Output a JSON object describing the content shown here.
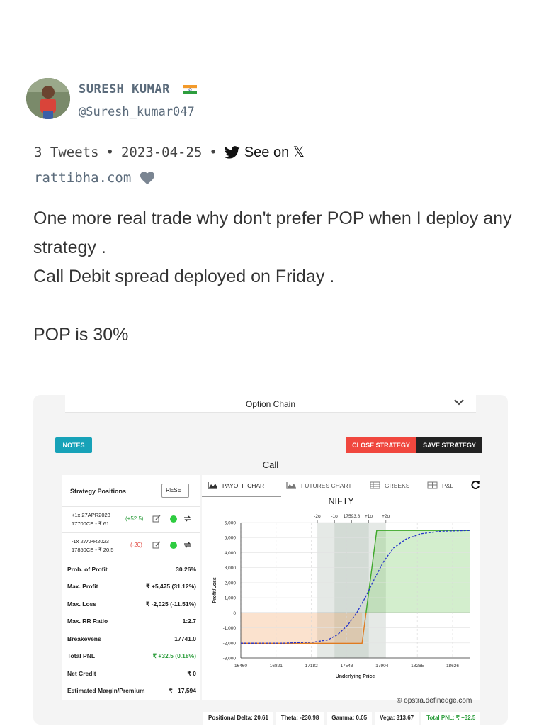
{
  "author": {
    "name": "SURESH KUMAR",
    "flag": "flag-india-icon",
    "handle": "@Suresh_kumar047"
  },
  "meta": {
    "tweets": "3 Tweets",
    "date": "2023-04-25",
    "see_on": "See on 𝕏",
    "site": "rattibha.com"
  },
  "tweet": {
    "line1": "One more real trade why don't prefer  POP when I deploy any strategy .",
    "line2": "Call Debit spread deployed on Friday .",
    "line3": "POP is 30%"
  },
  "screenshot": {
    "option_chain": "Option Chain",
    "notes": "NOTES",
    "close_strategy": "CLOSE STRATEGY",
    "save_strategy": "SAVE STRATEGY",
    "call": "Call",
    "positions_title": "Strategy Positions",
    "reset": "RESET",
    "positions": [
      {
        "line1": "+1x  27APR2023",
        "line2": "17700CE  - ₹ 61",
        "change": "(+52.5)",
        "change_color": "#2e9e3e"
      },
      {
        "line1": "-1x  27APR2023",
        "line2": "17850CE  - ₹ 20.5",
        "change": "(-20)",
        "change_color": "#e0443c"
      }
    ],
    "stats": [
      {
        "label": "Prob. of Profit",
        "value": "30.26%"
      },
      {
        "label": "Max. Profit",
        "value": "₹ +5,475 (31.12%)"
      },
      {
        "label": "Max. Loss",
        "value": "₹ -2,025 (-11.51%)"
      },
      {
        "label": "Max. RR Ratio",
        "value": "1:2.7"
      },
      {
        "label": "Breakevens",
        "value": "17741.0"
      },
      {
        "label": "Total PNL",
        "value": "₹ +32.5 (0.18%)",
        "color": "#2e9e3e"
      },
      {
        "label": "Net Credit",
        "value": "₹ 0"
      },
      {
        "label": "Estimated Margin/Premium",
        "value": "₹ +17,594"
      }
    ],
    "tabs": [
      "PAYOFF CHART",
      "FUTURES CHART",
      "GREEKS",
      "P&L"
    ],
    "chart_title": "NIFTY",
    "credit": "© opstra.definedge.com",
    "strip": [
      {
        "label": "Positional Delta: 20.61"
      },
      {
        "label": "Theta: -230.98"
      },
      {
        "label": "Gamma: 0.05"
      },
      {
        "label": "Vega: 313.67"
      },
      {
        "label": "Total PNL: ₹ +32.5",
        "color": "#2e9e3e"
      }
    ]
  },
  "chart_data": {
    "type": "line",
    "title": "NIFTY",
    "xlabel": "Underlying Price",
    "ylabel": "Profit/Loss",
    "xlim": [
      16460,
      18800
    ],
    "ylim": [
      -3000,
      6000
    ],
    "x_ticks": [
      "16460",
      "16821",
      "17182",
      "17543",
      "17904",
      "18265",
      "18626"
    ],
    "y_ticks": [
      "6,000",
      "5,000",
      "4,000",
      "3,000",
      "2,000",
      "1,000",
      "0",
      "-1,000",
      "-2,000",
      "-3,000"
    ],
    "top_markers": [
      {
        "label": "-2σ",
        "x": 17243
      },
      {
        "label": "-1σ",
        "x": 17418
      },
      {
        "label": "17593.8",
        "x": 17594
      },
      {
        "label": "+1σ",
        "x": 17769
      },
      {
        "label": "+2σ",
        "x": 17944
      }
    ],
    "sigma_bands": [
      {
        "from": 17243,
        "to": 17944,
        "color": "#e5e9e6"
      },
      {
        "from": 17418,
        "to": 17769,
        "color": "#d3dbd5"
      }
    ],
    "series": [
      {
        "color": "#e07b20",
        "x": [
          16460,
          17700,
          17741
        ],
        "y": [
          -2025,
          -2025,
          0
        ]
      },
      {
        "color": "#3ea82a",
        "x": [
          17741,
          17850,
          18800
        ],
        "y": [
          0,
          5475,
          5475
        ]
      },
      {
        "color": "#2433c9",
        "dashed": true,
        "x": [
          16460,
          16900,
          17200,
          17350,
          17450,
          17550,
          17650,
          17740,
          17830,
          17920,
          18020,
          18150,
          18300,
          18500,
          18800
        ],
        "y": [
          -2020,
          -2015,
          -1950,
          -1800,
          -1450,
          -850,
          50,
          1100,
          2300,
          3400,
          4300,
          4900,
          5250,
          5420,
          5470
        ]
      }
    ]
  }
}
